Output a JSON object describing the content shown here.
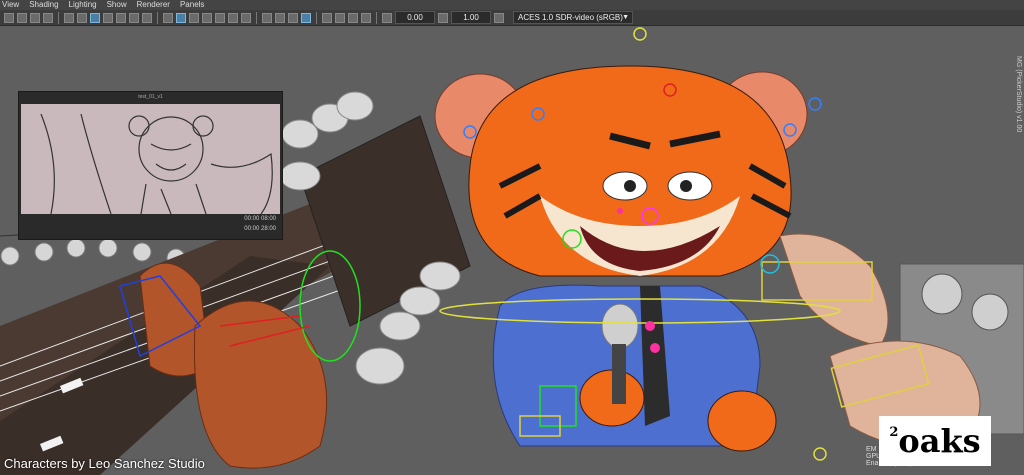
{
  "menu": [
    "View",
    "Shading",
    "Lighting",
    "Show",
    "Renderer",
    "Panels"
  ],
  "toolbar": {
    "exposure": "0.00",
    "gamma": "1.00",
    "colorspace": "ACES 1.0 SDR-video (sRGB)"
  },
  "side_label": "MG (PickerStudio) v1.00",
  "thumbnail": {
    "title": "test_01_v1",
    "timecode_1": "00:00 08:00",
    "timecode_2": "00:00 28:00"
  },
  "hud": {
    "line1": "EM",
    "line2": "GPU Override",
    "line3": "Enabled (auto)"
  },
  "credit": "Characters by Leo Sanchez Studio",
  "logo": {
    "sup": "2",
    "word": "oaks"
  },
  "colors": {
    "tiger_orange": "#f06a1a",
    "jacket_blue": "#4c6fd0",
    "guitar_body": "#2f2a26",
    "skin": "#b2552b",
    "ui_dark": "#3c3c3c"
  }
}
